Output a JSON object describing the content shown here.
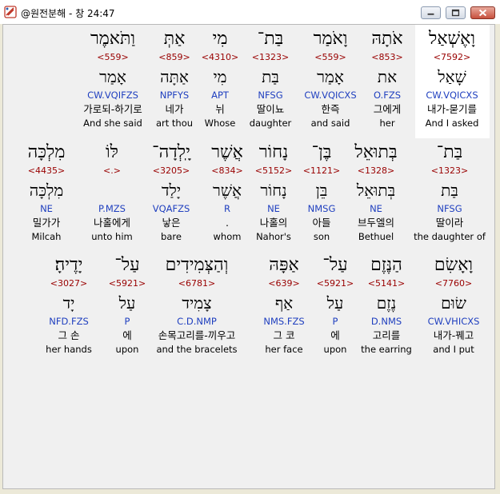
{
  "window": {
    "title": "@원전분해 - 창 24:47",
    "icons": {
      "app": "bible-app-icon",
      "minimize": "minimize-icon",
      "maximize": "maximize-icon",
      "close": "close-icon"
    }
  },
  "colors": {
    "strong": "#990000",
    "morph": "#1f3fbf",
    "selected_bg": "#ffffff",
    "panel_bg": "#f0f0f0"
  },
  "rows": [
    {
      "words": [
        {
          "heb": "וָאֶשְׁאַל",
          "strong": "<7592>",
          "lemma": "שָׁאַל",
          "morph": "CW.VQICXS",
          "kor": "내가-묻기를",
          "eng": "And I asked",
          "selected": true
        },
        {
          "heb": "אֹתָהּ",
          "strong": "<853>",
          "lemma": "את",
          "morph": "O.FZS",
          "kor": "그에게",
          "eng": "her"
        },
        {
          "heb": "וָאֹמַר",
          "strong": "<559>",
          "lemma": "אָמַר",
          "morph": "CW.VQICXS",
          "kor": "한즉",
          "eng": "and said"
        },
        {
          "heb": "בַּת־",
          "strong": "<1323>",
          "lemma": "בַּת",
          "morph": "NFSG",
          "kor": "딸이뇨",
          "eng": "daughter"
        },
        {
          "heb": "מִי",
          "strong": "<4310>",
          "lemma": "מִי",
          "morph": "APT",
          "kor": "뉘",
          "eng": "Whose"
        },
        {
          "heb": "אַתְּ",
          "strong": "<859>",
          "lemma": "אַתָּה",
          "morph": "NPFYS",
          "kor": "네가",
          "eng": "art thou"
        },
        {
          "heb": "וַתֹּאמֶר",
          "strong": "<559>",
          "lemma": "אָמַר",
          "morph": "CW.VQIFZS",
          "kor": "가로되-하기로",
          "eng": "And she said"
        }
      ]
    },
    {
      "words": [
        {
          "heb": "בַּת־",
          "strong": "<1323>",
          "lemma": "בַּת",
          "morph": "NFSG",
          "kor": "딸이라",
          "eng": "the daughter of"
        },
        {
          "heb": "בְּתוּאֵל",
          "strong": "<1328>",
          "lemma": "בְּתוּאֵל",
          "morph": "NE",
          "kor": "브두엘의",
          "eng": "Bethuel"
        },
        {
          "heb": "בֶּן־",
          "strong": "<1121>",
          "lemma": "בֵּן",
          "morph": "NMSG",
          "kor": "아들",
          "eng": "son"
        },
        {
          "heb": "נָחוֹר",
          "strong": "<5152>",
          "lemma": "נָחוֹר",
          "morph": "NE",
          "kor": "나홀의",
          "eng": "Nahor's"
        },
        {
          "heb": "אֲשֶׁר",
          "strong": "<834>",
          "lemma": "אֲשֶׁר",
          "morph": "R",
          "kor": ".",
          "eng": "whom"
        },
        {
          "heb": "יָֽלְדָה־",
          "strong": "<3205>",
          "lemma": "יָלַד",
          "morph": "VQAFZS",
          "kor": "낳은",
          "eng": "bare"
        },
        {
          "heb": "לּוֹ",
          "strong": "<.>",
          "lemma": "",
          "morph": "P.MZS",
          "kor": "나홀에게",
          "eng": "unto him"
        },
        {
          "heb": "מִלְכָּה",
          "strong": "<4435>",
          "lemma": "מִלְכָּה",
          "morph": "NE",
          "kor": "밀가가",
          "eng": "Milcah"
        }
      ]
    },
    {
      "words": [
        {
          "heb": "וָאָשִׂם",
          "strong": "<7760>",
          "lemma": "שׂוּם",
          "morph": "CW.VHICXS",
          "kor": "내가-꿰고",
          "eng": "and I put"
        },
        {
          "heb": "הַנֶּזֶם",
          "strong": "<5141>",
          "lemma": "נֶזֶם",
          "morph": "D.NMS",
          "kor": "고리를",
          "eng": "the earring"
        },
        {
          "heb": "עַל־",
          "strong": "<5921>",
          "lemma": "עַל",
          "morph": "P",
          "kor": "에",
          "eng": "upon"
        },
        {
          "heb": "אַפָּהּ",
          "strong": "<639>",
          "lemma": "אַף",
          "morph": "NMS.FZS",
          "kor": "그 코",
          "eng": "her face"
        },
        {
          "heb": "וְהַצְּמִידִים",
          "strong": "<6781>",
          "lemma": "צָמִיד",
          "morph": "C.D.NMP",
          "kor": "손목고리를-끼우고",
          "eng": "and the bracelets"
        },
        {
          "heb": "עַל־",
          "strong": "<5921>",
          "lemma": "עַל",
          "morph": "P",
          "kor": "에",
          "eng": "upon"
        },
        {
          "heb": "יָדֶיהָ׃",
          "strong": "<3027>",
          "lemma": "יָד",
          "morph": "NFD.FZS",
          "kor": "그 손",
          "eng": "her hands"
        }
      ]
    }
  ]
}
